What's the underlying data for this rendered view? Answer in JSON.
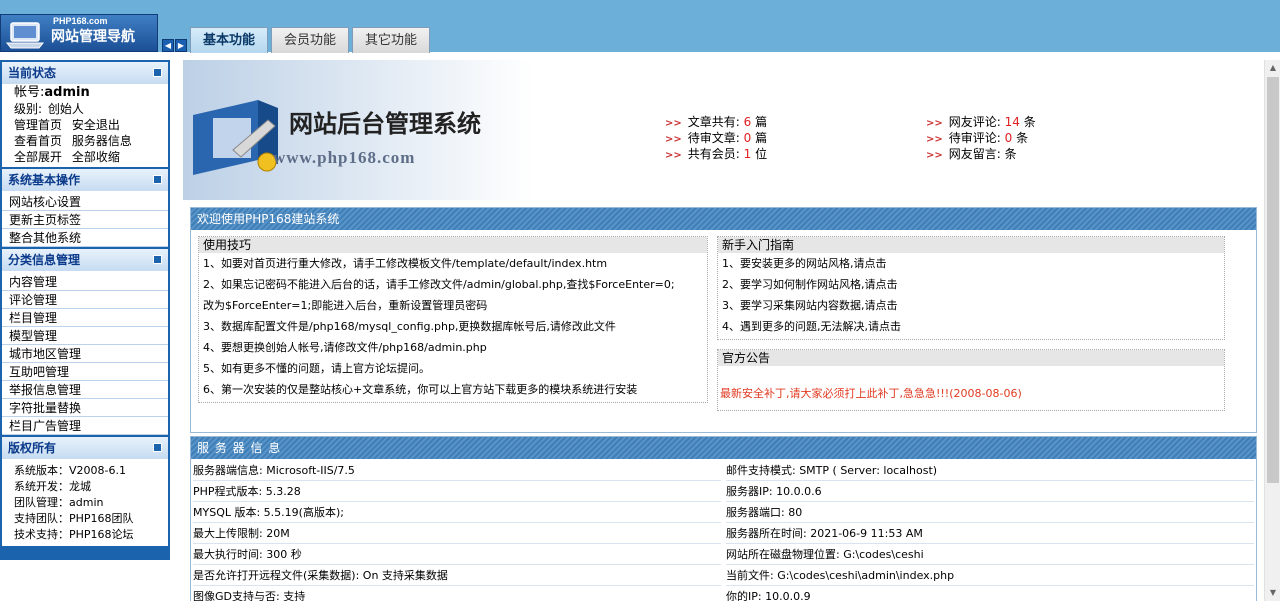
{
  "header": {
    "logo_small": "PHP168.com",
    "logo_title": "网站管理导航",
    "tabs": [
      "基本功能",
      "会员功能",
      "其它功能"
    ]
  },
  "sidebar": {
    "status": {
      "title": "当前状态",
      "account_label": "帐号:",
      "account_value": "admin",
      "level_label": "级别:",
      "level_value": "创始人",
      "links": [
        [
          "管理首页",
          "安全退出"
        ],
        [
          "查看首页",
          "服务器信息"
        ],
        [
          "全部展开",
          "全部收缩"
        ]
      ]
    },
    "basic": {
      "title": "系统基本操作",
      "items": [
        "网站核心设置",
        "更新主页标签",
        "整合其他系统"
      ]
    },
    "category": {
      "title": "分类信息管理",
      "items": [
        "内容管理",
        "评论管理",
        "栏目管理",
        "模型管理",
        "城市地区管理",
        "互助吧管理",
        "举报信息管理",
        "字符批量替换",
        "栏目广告管理"
      ]
    },
    "copyright": {
      "title": "版权所有",
      "lines": [
        "系统版本：V2008-6.1",
        "系统开发：龙城",
        "团队管理：admin",
        "支持团队：PHP168团队",
        "技术支持：PHP168论坛"
      ]
    }
  },
  "banner": {
    "title": "网站后台管理系统",
    "url": "www.php168.com"
  },
  "stats": {
    "left": [
      {
        "label": "文章共有:",
        "value": "6",
        "unit": "篇"
      },
      {
        "label": "待审文章:",
        "value": "0",
        "unit": "篇"
      },
      {
        "label": "共有会员:",
        "value": "1",
        "unit": "位"
      }
    ],
    "right": [
      {
        "label": "网友评论:",
        "value": "14",
        "unit": "条"
      },
      {
        "label": "待审评论:",
        "value": "0",
        "unit": "条"
      },
      {
        "label": "网友留言:",
        "value": "",
        "unit": "条"
      }
    ]
  },
  "welcome": {
    "title": "欢迎使用PHP168建站系统",
    "tips_title": "使用技巧",
    "tips": [
      "1、如要对首页进行重大修改，请手工修改模板文件/template/default/index.htm",
      "2、如果忘记密码不能进入后台的话，请手工修改文件/admin/global.php,查找$ForceEnter=0;",
      "改为$ForceEnter=1;即能进入后台，重新设置管理员密码",
      "3、数据库配置文件是/php168/mysql_config.php,更换数据库帐号后,请修改此文件",
      "4、要想更换创始人帐号,请修改文件/php168/admin.php",
      "5、如有更多不懂的问题，请上官方论坛提问。",
      "6、第一次安装的仅是整站核心+文章系统，你可以上官方站下载更多的模块系统进行安装"
    ],
    "guide_title": "新手入门指南",
    "guide": [
      "1、要安装更多的网站风格,请点击",
      "2、要学习如何制作网站风格,请点击",
      "3、要学习采集网站内容数据,请点击",
      "4、遇到更多的问题,无法解决,请点击"
    ],
    "notice_title": "官方公告",
    "notice": "最新安全补丁,请大家必须打上此补丁,急急急!!!(2008-08-06)"
  },
  "server": {
    "title": "服 务 器 信 息",
    "left": [
      "服务器端信息:  Microsoft-IIS/7.5",
      "PHP程式版本:  5.3.28",
      "MYSQL 版本:  5.5.19(高版本);",
      "最大上传限制:  20M",
      "最大执行时间:  300 秒",
      "是否允许打开远程文件(采集数据): On 支持采集数据",
      "图像GD支持与否: 支持"
    ],
    "right": [
      "邮件支持模式:  SMTP ( Server: localhost)",
      "服务器IP:  10.0.0.6",
      "服务器端口:  80",
      "服务器所在时间:  2021-06-9 11:53 AM",
      "网站所在磁盘物理位置:  G:\\codes\\ceshi",
      "当前文件: G:\\codes\\ceshi\\admin\\index.php",
      "你的IP:  10.0.0.9"
    ]
  },
  "colors": {
    "topbar": "#6cb0d9",
    "sidebar": "#1b63ad",
    "accent_red": "#e02020"
  }
}
